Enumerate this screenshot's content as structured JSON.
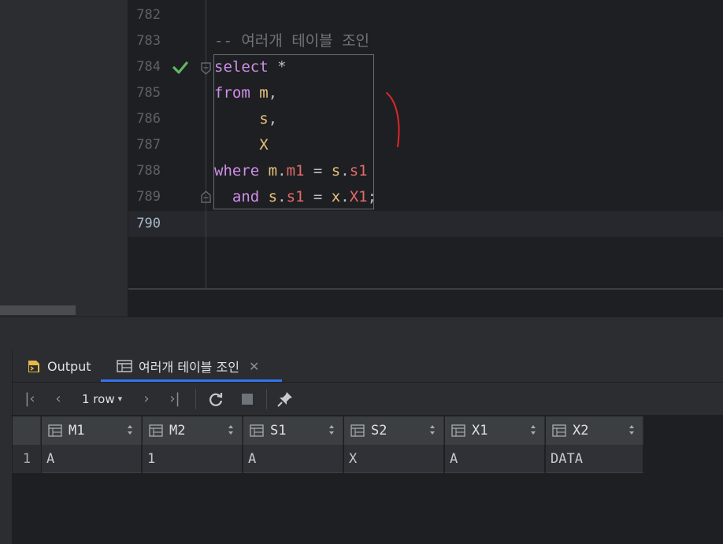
{
  "editor": {
    "lines": [
      {
        "num": "782"
      },
      {
        "num": "783",
        "comment": "-- 여러개 테이블 조인"
      },
      {
        "num": "784",
        "t1": "select",
        "t2": " *"
      },
      {
        "num": "785",
        "t1": "from",
        "t2": " ",
        "t3": "m",
        "t4": ","
      },
      {
        "num": "786",
        "t1": "     ",
        "t3": "s",
        "t4": ","
      },
      {
        "num": "787",
        "t1": "     ",
        "t3": "X"
      },
      {
        "num": "788",
        "kw": "where",
        "a": "m",
        "b": ".",
        "c": "m1",
        "d": " = ",
        "e": "s",
        "f": ".",
        "g": "s1"
      },
      {
        "num": "789",
        "kw": "and",
        "a": "s",
        "b": ".",
        "c": "s1",
        "d": " = ",
        "e": "x",
        "f": ".",
        "g": "X1",
        "h": ";"
      },
      {
        "num": "790"
      }
    ]
  },
  "tabs": {
    "output_label": "Output",
    "result_label": "여러개 테이블 조인"
  },
  "toolbar": {
    "row_count": "1 row"
  },
  "grid": {
    "columns": [
      "M1",
      "M2",
      "S1",
      "S2",
      "X1",
      "X2"
    ],
    "rows": [
      {
        "num": "1",
        "cells": [
          "A",
          "1",
          "A",
          "X",
          "A",
          "DATA"
        ]
      }
    ]
  },
  "colors": {
    "keyword": "#cf8ee8",
    "identifier": "#e8c07d",
    "column": "#e36a6a",
    "accent": "#3574f0",
    "success": "#5fb85f"
  }
}
